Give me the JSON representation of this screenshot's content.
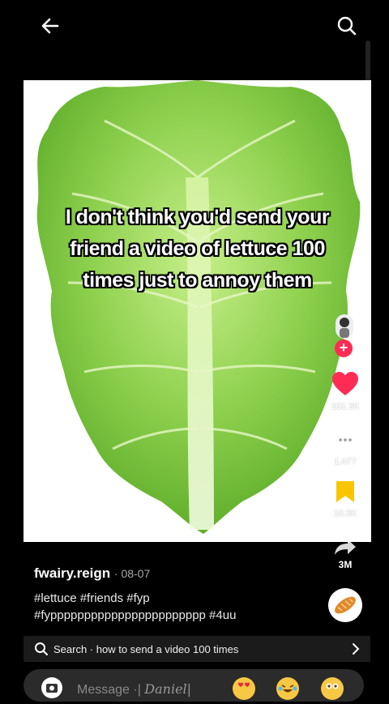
{
  "top_bar": {
    "back_icon": "arrow-left-icon",
    "search_icon": "search-icon"
  },
  "video": {
    "overlay_lines": [
      "I don't think you'd send your",
      "friend a video of lettuce 100",
      "times just to annoy them"
    ]
  },
  "actions": {
    "likes": "101.3K",
    "comments": "1,477",
    "saves": "10.3K",
    "shares": "3M",
    "follow_label": "+"
  },
  "post": {
    "author": "fwairy.reign",
    "date": "· 08-07",
    "hashtags_line1": "#lettuce #friends #fyp",
    "hashtags_line2": "#fyppppppppppppppppppppppp #4uu"
  },
  "search_bar": {
    "text": "Search · how to send a video 100 times"
  },
  "comment_bar": {
    "placeholder": "Message ·| ",
    "signature": "Daniel|"
  },
  "colors": {
    "accent": "#fe2c55",
    "save": "#f7c600",
    "lettuce": "#8fd14f"
  }
}
